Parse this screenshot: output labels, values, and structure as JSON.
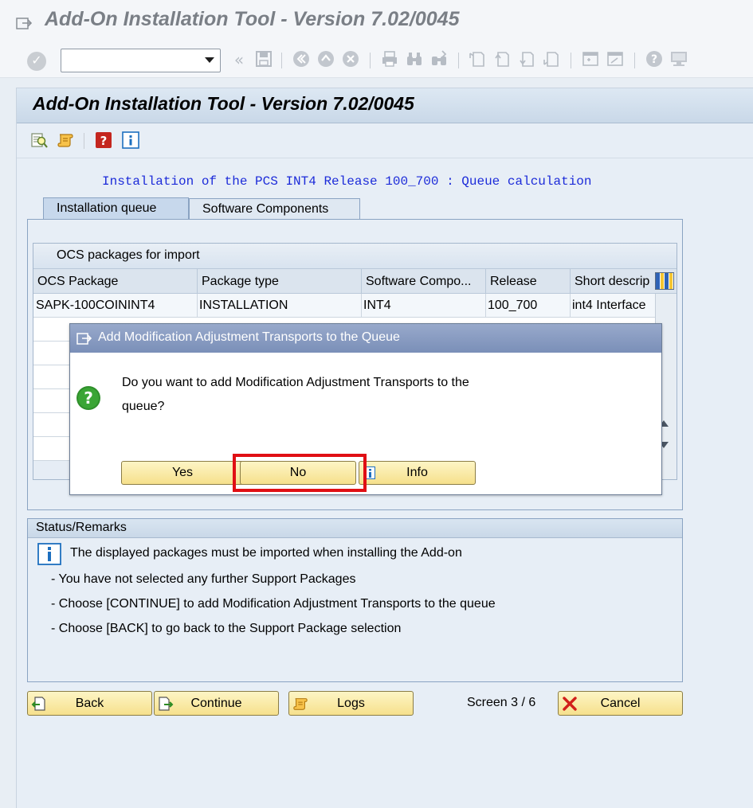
{
  "window": {
    "title": "Add-On Installation Tool - Version 7.02/0045"
  },
  "toolbar": {
    "command_field_value": ""
  },
  "screen": {
    "title": "Add-On Installation Tool - Version 7.02/0045",
    "heading": "Installation of the PCS INT4 Release 100_700 : Queue calculation"
  },
  "tabs": [
    {
      "label": "Installation queue",
      "active": true
    },
    {
      "label": "Software Components",
      "active": false
    }
  ],
  "table": {
    "title": "OCS packages for import",
    "columns": [
      "OCS Package",
      "Package type",
      "Software Compo...",
      "Release",
      "Short descrip"
    ],
    "rows": [
      [
        "SAPK-100COININT4",
        "INSTALLATION",
        "INT4",
        "100_700",
        "int4 Interface"
      ]
    ]
  },
  "dialog": {
    "title": "Add Modification Adjustment Transports to the Queue",
    "message": "Do you want to add Modification Adjustment Transports to the queue?",
    "buttons": {
      "yes": "Yes",
      "no": "No",
      "info": "Info"
    },
    "highlighted_button": "No"
  },
  "status": {
    "title": "Status/Remarks",
    "lines": [
      "The displayed packages must be imported when installing the Add-on",
      "- You have not selected any further Support Packages",
      "- Choose [CONTINUE] to add Modification Adjustment Transports to the queue",
      "- Choose [BACK] to go back to the Support Package selection"
    ]
  },
  "footer": {
    "back": "Back",
    "continue": "Continue",
    "logs": "Logs",
    "screen_counter": "Screen 3 / 6",
    "cancel": "Cancel"
  },
  "colors": {
    "heading_blue": "#1c2bd9",
    "button_yellow": "#f6e08c",
    "highlight_red": "#e00f14",
    "dialog_title": "#7a8fb8"
  },
  "icons": [
    "exit-icon",
    "enter-icon",
    "save-icon",
    "back-icon",
    "exit-nav-icon",
    "cancel-nav-icon",
    "print-icon",
    "find-icon",
    "find-next-icon",
    "first-page-icon",
    "previous-page-icon",
    "next-page-icon",
    "last-page-icon",
    "new-session-icon",
    "shortcut-icon",
    "help-icon",
    "customize-icon",
    "question-icon",
    "info-icon"
  ]
}
